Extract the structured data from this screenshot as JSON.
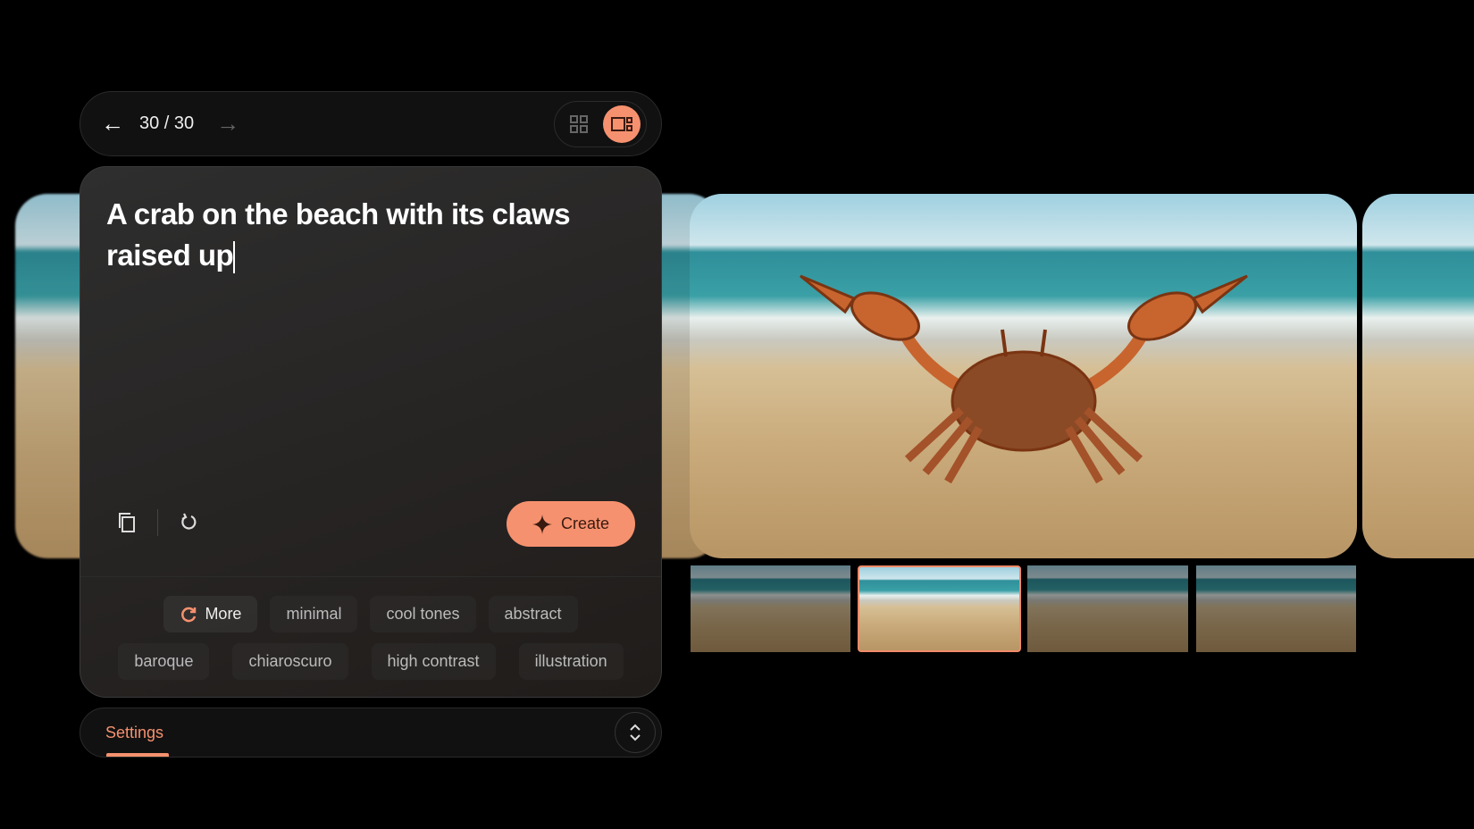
{
  "nav": {
    "counter": "30 / 30",
    "back_icon": "arrow-left-icon",
    "forward_icon": "arrow-right-icon",
    "views": [
      "grid-view-icon",
      "detail-view-icon"
    ],
    "active_view": "detail"
  },
  "prompt": {
    "text": "A crab on the beach with its claws raised up"
  },
  "actions": {
    "copy_icon": "copy-icon",
    "reset_icon": "reset-icon",
    "create_label": "Create"
  },
  "chips": {
    "more_label": "More",
    "row1": [
      "minimal",
      "cool tones",
      "abstract"
    ],
    "row2": [
      "baroque",
      "chiaroscuro",
      "high contrast",
      "illustration"
    ]
  },
  "settings": {
    "label": "Settings"
  },
  "gallery": {
    "thumbnail_count": 4,
    "selected_thumbnail": 2
  },
  "colors": {
    "accent": "#f6916f",
    "background": "#000000"
  }
}
